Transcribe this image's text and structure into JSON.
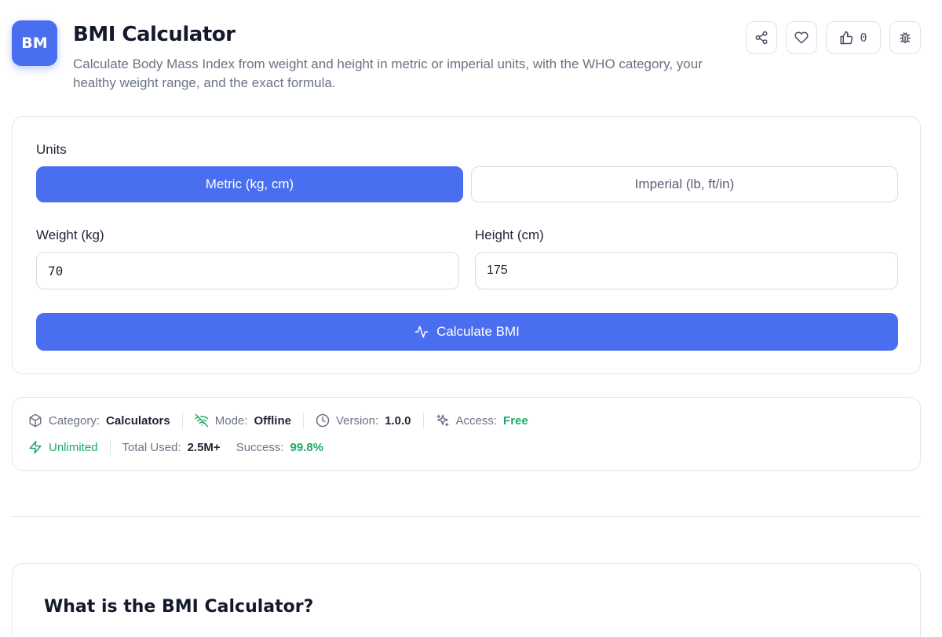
{
  "header": {
    "icon_text": "BM",
    "title": "BMI Calculator",
    "description": "Calculate Body Mass Index from weight and height in metric or imperial units, with the WHO category, your healthy weight range, and the exact formula.",
    "like_count": "0",
    "actions": [
      "share-icon",
      "heart-icon",
      "thumbs-up-icon",
      "bug-icon"
    ]
  },
  "form": {
    "units_label": "Units",
    "unit_options": [
      "Metric (kg, cm)",
      "Imperial (lb, ft/in)"
    ],
    "selected_unit": "Metric (kg, cm)",
    "weight_label": "Weight (kg)",
    "weight_value": "70",
    "height_label": "Height (cm)",
    "height_value": "175",
    "calculate_label": "Calculate BMI"
  },
  "meta": {
    "category_label": "Category:",
    "category_value": "Calculators",
    "mode_label": "Mode:",
    "mode_value": "Offline",
    "version_label": "Version:",
    "version_value": "1.0.0",
    "access_label": "Access:",
    "access_value": "Free",
    "unlimited_label": "Unlimited",
    "total_label": "Total Used:",
    "total_value": "2.5M+",
    "success_label": "Success:",
    "success_value": "99.8%"
  },
  "what": {
    "title": "What is the BMI Calculator?"
  },
  "colors": {
    "accent": "#4a6ef0",
    "green": "#1fa866",
    "text": "#1e2433",
    "muted": "#6b7385",
    "border": "#e3e6ec"
  }
}
